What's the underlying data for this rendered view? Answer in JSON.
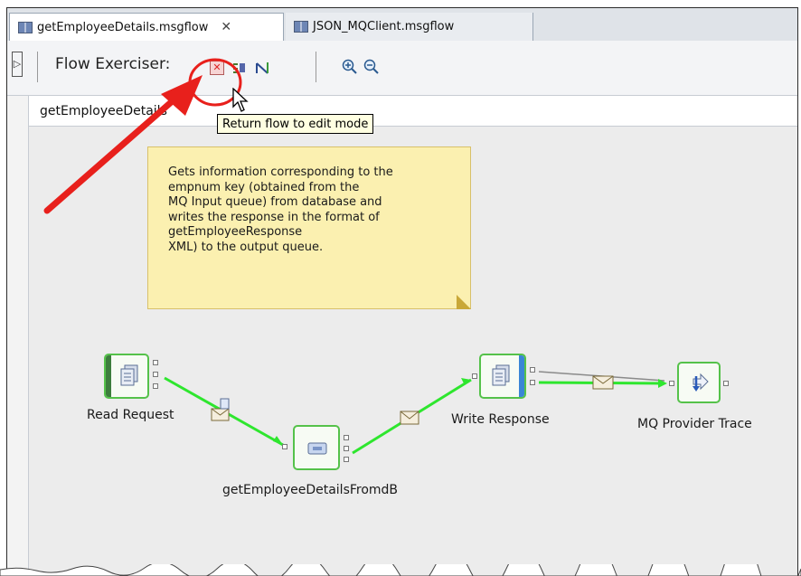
{
  "tabs": [
    {
      "label": "getEmployeeDetails.msgflow",
      "active": true
    },
    {
      "label": "JSON_MQClient.msgflow",
      "active": false
    }
  ],
  "toolbar": {
    "flow_exerciser_label": "Flow Exerciser:",
    "tooltip": "Return flow to edit mode"
  },
  "breadcrumb": "getEmployeeDetails",
  "note": {
    "text": "Gets information corresponding to the\nempnum key (obtained from the\nMQ Input queue) from database and\nwrites the response in the format of\ngetEmployeeResponse\nXML) to the output queue."
  },
  "nodes": {
    "read_request": "Read Request",
    "compute": "getEmployeeDetailsFromdB",
    "write_response": "Write Response",
    "trace": "MQ Provider Trace"
  },
  "colors": {
    "connection": "#2ee62e",
    "annotation": "#e8201c",
    "node_border": "#55c24a"
  },
  "icons": [
    "msgflow-icon",
    "close-tab-icon",
    "collapse-icon",
    "stop-flow-icon",
    "view-messages-icon",
    "record-path-icon",
    "zoom-in-icon",
    "zoom-out-icon",
    "envelope-icon",
    "mouse-cursor-icon"
  ]
}
